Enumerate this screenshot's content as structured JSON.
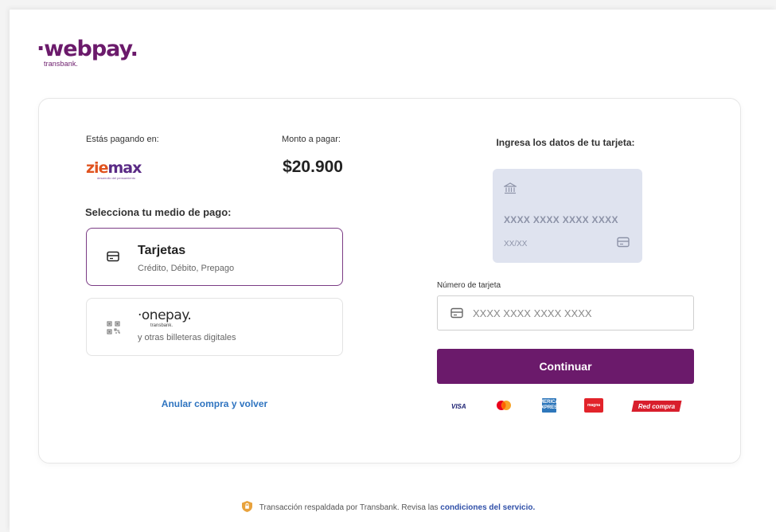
{
  "header": {
    "logo_text": "·webpay.",
    "logo_sub": "transbank."
  },
  "payment": {
    "paying_at_label": "Estás pagando en:",
    "amount_label": "Monto a pagar:",
    "amount": "$20.900",
    "merchant_logo": {
      "name_part1": "zie",
      "name_part2": "max",
      "tagline": "desarrollo del pensamiento"
    },
    "select_method_label": "Selecciona tu medio de pago:"
  },
  "methods": [
    {
      "title": "Tarjetas",
      "subtitle": "Crédito, Débito, Prepago",
      "icon": "credit-card-icon",
      "selected": true
    },
    {
      "title": "·onepay.",
      "brand_sub": "transbank.",
      "subtitle": "y otras billeteras digitales",
      "icon": "qr-code-icon",
      "selected": false
    }
  ],
  "cancel_link": "Anular compra y volver",
  "card_form": {
    "title": "Ingresa los datos de tu tarjeta:",
    "preview_number": "XXXX XXXX XXXX XXXX",
    "preview_expiry": "XX/XX",
    "number_label": "Número de tarjeta",
    "number_placeholder": "XXXX XXXX XXXX XXXX",
    "number_value": "",
    "continue_label": "Continuar"
  },
  "brands": [
    "VISA",
    "mastercard",
    "AMEX",
    "magna",
    "Red compra"
  ],
  "brand_texts": {
    "visa": "VISA",
    "amex": "AMERICAN EXPRESS",
    "magna": "magna",
    "redcompra": "Red compra"
  },
  "footer": {
    "text": "Transacción respaldada por Transbank. Revisa las",
    "link": "condiciones del servicio."
  },
  "colors": {
    "brand_purple": "#6b1a6b",
    "link_blue": "#2f74c0",
    "card_preview_bg": "#dfe3ef",
    "shield_orange": "#e8a23c"
  }
}
